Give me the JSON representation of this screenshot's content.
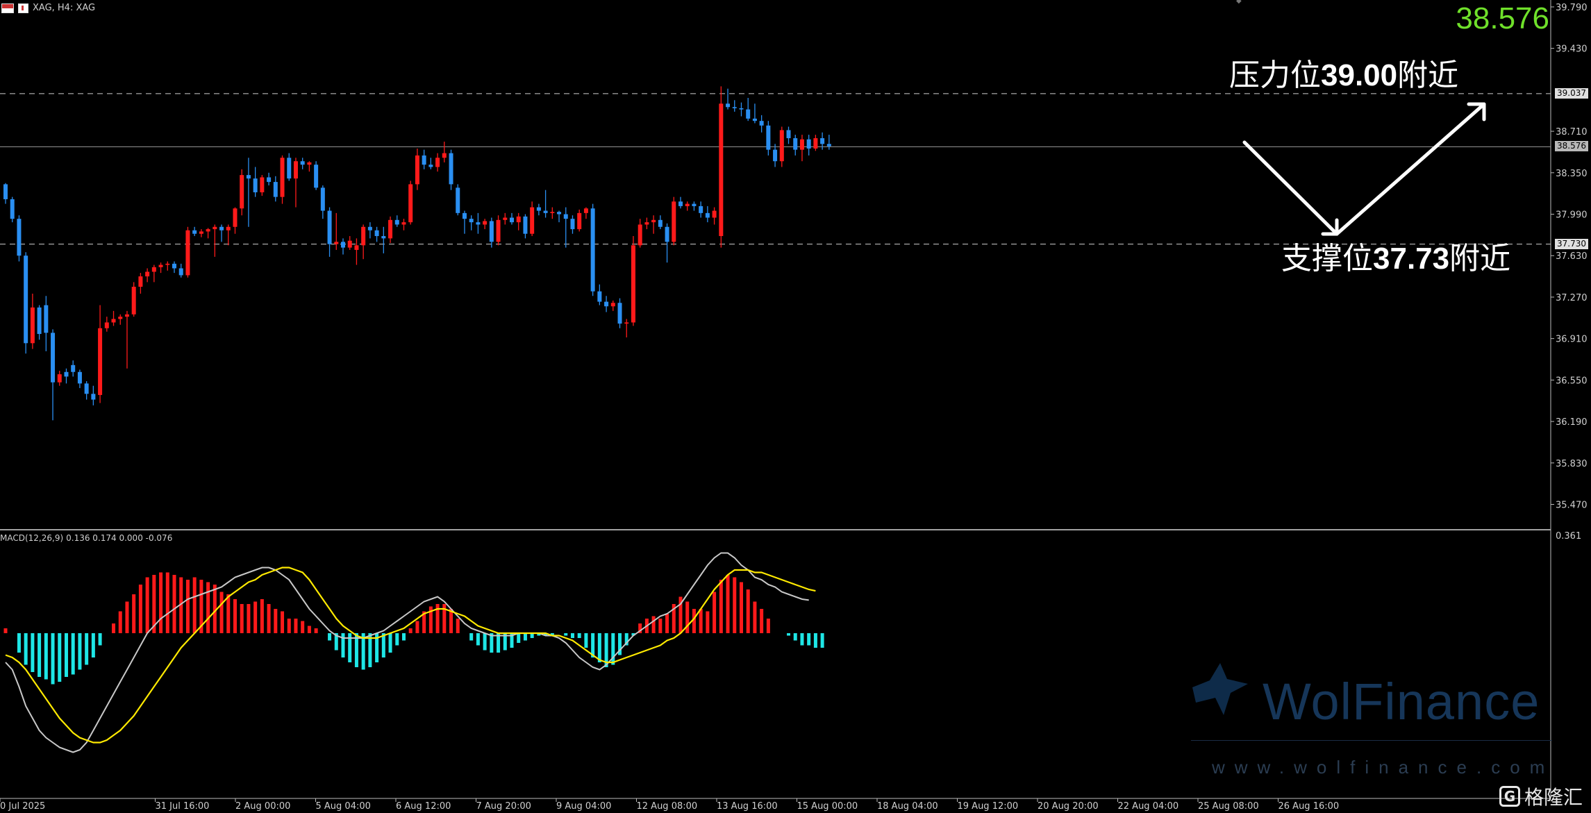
{
  "header": {
    "symbol": "XAG, H4:  XAG"
  },
  "big_price": "38.576",
  "annotations": {
    "resistance_prefix": "压力位",
    "resistance_value": "39.00",
    "resistance_suffix": "附近",
    "support_prefix": "支撑位",
    "support_value": "37.73",
    "support_suffix": "附近"
  },
  "price_axis": {
    "ticks": [
      "39.790",
      "39.430",
      "38.710",
      "38.350",
      "37.990",
      "37.630",
      "37.270",
      "36.910",
      "36.550",
      "36.190",
      "35.830",
      "35.470"
    ],
    "tags": [
      {
        "label": "39.037",
        "value": 39.037,
        "color": "#e0e0e0"
      },
      {
        "label": "38.576",
        "value": 38.576,
        "color": "#b8b8b8"
      },
      {
        "label": "37.730",
        "value": 37.73,
        "color": "#e0e0e0"
      }
    ]
  },
  "macd": {
    "label_name": "MACD(12,26,9)",
    "label_values": "0.136 0.174 0.000 -0.076",
    "axis_top": "0.361"
  },
  "time_axis": [
    "0 Jul 2025",
    "31 Jul 16:00",
    "2 Aug 00:00",
    "5 Aug 04:00",
    "6 Aug 12:00",
    "7 Aug 20:00",
    "9 Aug 04:00",
    "12 Aug 08:00",
    "13 Aug 16:00",
    "15 Aug 00:00",
    "18 Aug 04:00",
    "19 Aug 12:00",
    "20 Aug 20:00",
    "22 Aug 04:00",
    "25 Aug 08:00",
    "26 Aug 16:00"
  ],
  "watermark": {
    "brand": "WolFinance",
    "url": "www.wolfinance.com"
  },
  "corner_brand": {
    "icon": "G",
    "text": "格隆汇"
  },
  "colors": {
    "bull": "#ff1a1a",
    "bear": "#2a8ff2",
    "hist_pos": "#ff1a1a",
    "hist_neg": "#1ee6e6",
    "main_line": "#c8c8c8",
    "signal_line": "#ffea00",
    "price_accent": "#6fe02a"
  },
  "chart_data": {
    "type": "candlestick",
    "title": "XAG, H4",
    "ylim": [
      35.25,
      39.85
    ],
    "ohlc": [
      [
        38.25,
        38.26,
        38.08,
        38.12
      ],
      [
        38.12,
        38.14,
        37.92,
        37.95
      ],
      [
        37.95,
        37.98,
        37.58,
        37.63
      ],
      [
        37.63,
        37.66,
        36.78,
        36.87
      ],
      [
        36.87,
        37.3,
        36.82,
        37.18
      ],
      [
        37.18,
        37.2,
        36.9,
        36.95
      ],
      [
        37.2,
        37.28,
        36.8,
        36.96
      ],
      [
        36.96,
        36.99,
        36.2,
        36.53
      ],
      [
        36.53,
        36.63,
        36.5,
        36.6
      ],
      [
        36.62,
        36.65,
        36.52,
        36.58
      ],
      [
        36.68,
        36.72,
        36.58,
        36.62
      ],
      [
        36.62,
        36.64,
        36.48,
        36.52
      ],
      [
        36.52,
        36.54,
        36.38,
        36.43
      ],
      [
        36.43,
        36.5,
        36.33,
        36.38
      ],
      [
        36.42,
        37.2,
        36.35,
        37.0
      ],
      [
        37.0,
        37.1,
        36.97,
        37.05
      ],
      [
        37.05,
        37.15,
        37.02,
        37.08
      ],
      [
        37.08,
        37.12,
        37.03,
        37.1
      ],
      [
        37.1,
        37.15,
        36.65,
        37.12
      ],
      [
        37.12,
        37.4,
        37.1,
        37.36
      ],
      [
        37.36,
        37.48,
        37.3,
        37.45
      ],
      [
        37.45,
        37.52,
        37.4,
        37.49
      ],
      [
        37.49,
        37.55,
        37.4,
        37.53
      ],
      [
        37.53,
        37.57,
        37.48,
        37.55
      ],
      [
        37.55,
        37.58,
        37.5,
        37.56
      ],
      [
        37.56,
        37.58,
        37.48,
        37.52
      ],
      [
        37.52,
        37.56,
        37.44,
        37.46
      ],
      [
        37.46,
        37.88,
        37.44,
        37.85
      ],
      [
        37.85,
        37.88,
        37.8,
        37.82
      ],
      [
        37.82,
        37.86,
        37.79,
        37.84
      ],
      [
        37.84,
        37.87,
        37.78,
        37.86
      ],
      [
        37.86,
        37.9,
        37.62,
        37.88
      ],
      [
        37.88,
        37.9,
        37.75,
        37.85
      ],
      [
        37.85,
        37.9,
        37.72,
        37.88
      ],
      [
        37.88,
        38.05,
        37.82,
        38.04
      ],
      [
        38.04,
        38.38,
        37.98,
        38.33
      ],
      [
        38.33,
        38.48,
        37.88,
        38.3
      ],
      [
        38.3,
        38.4,
        38.14,
        38.18
      ],
      [
        38.18,
        38.33,
        38.15,
        38.31
      ],
      [
        38.31,
        38.35,
        38.24,
        38.27
      ],
      [
        38.27,
        38.32,
        38.1,
        38.14
      ],
      [
        38.14,
        38.5,
        38.08,
        38.48
      ],
      [
        38.48,
        38.52,
        38.28,
        38.3
      ],
      [
        38.3,
        38.48,
        38.05,
        38.45
      ],
      [
        38.45,
        38.48,
        38.38,
        38.42
      ],
      [
        38.42,
        38.45,
        38.36,
        38.44
      ],
      [
        38.42,
        38.45,
        38.2,
        38.22
      ],
      [
        38.22,
        38.24,
        37.95,
        38.02
      ],
      [
        38.02,
        38.05,
        37.62,
        37.73
      ],
      [
        37.73,
        38.0,
        37.68,
        37.75
      ],
      [
        37.75,
        37.78,
        37.64,
        37.7
      ],
      [
        37.7,
        37.8,
        37.68,
        37.76
      ],
      [
        37.68,
        37.78,
        37.55,
        37.72
      ],
      [
        37.72,
        37.9,
        37.6,
        37.88
      ],
      [
        37.88,
        37.92,
        37.78,
        37.85
      ],
      [
        37.85,
        37.88,
        37.75,
        37.8
      ],
      [
        37.8,
        37.88,
        37.65,
        37.78
      ],
      [
        37.78,
        37.97,
        37.74,
        37.94
      ],
      [
        37.94,
        37.98,
        37.88,
        37.9
      ],
      [
        37.9,
        37.95,
        37.85,
        37.92
      ],
      [
        37.92,
        38.28,
        37.9,
        38.25
      ],
      [
        38.25,
        38.56,
        38.2,
        38.5
      ],
      [
        38.5,
        38.55,
        38.38,
        38.42
      ],
      [
        38.42,
        38.48,
        38.38,
        38.4
      ],
      [
        38.4,
        38.52,
        38.36,
        38.48
      ],
      [
        38.48,
        38.62,
        38.44,
        38.52
      ],
      [
        38.52,
        38.55,
        38.2,
        38.25
      ],
      [
        38.22,
        38.25,
        37.98,
        38.0
      ],
      [
        38.0,
        38.02,
        37.82,
        37.95
      ],
      [
        37.95,
        37.98,
        37.85,
        37.92
      ],
      [
        37.92,
        38.0,
        37.82,
        37.9
      ],
      [
        37.9,
        37.95,
        37.86,
        37.93
      ],
      [
        37.93,
        37.96,
        37.7,
        37.75
      ],
      [
        37.75,
        37.98,
        37.72,
        37.94
      ],
      [
        37.94,
        38.0,
        37.9,
        37.96
      ],
      [
        37.96,
        38.0,
        37.9,
        37.92
      ],
      [
        37.92,
        38.0,
        37.85,
        37.97
      ],
      [
        37.97,
        37.99,
        37.78,
        37.82
      ],
      [
        37.82,
        38.1,
        37.8,
        38.05
      ],
      [
        38.05,
        38.08,
        37.98,
        38.02
      ],
      [
        38.02,
        38.2,
        37.96,
        38.0
      ],
      [
        38.0,
        38.05,
        37.95,
        38.01
      ],
      [
        38.01,
        38.02,
        37.92,
        37.99
      ],
      [
        37.99,
        38.05,
        37.7,
        37.95
      ],
      [
        37.95,
        37.98,
        37.82,
        37.86
      ],
      [
        37.86,
        38.03,
        37.84,
        38.0
      ],
      [
        38.0,
        38.05,
        37.95,
        38.04
      ],
      [
        38.04,
        38.08,
        37.28,
        37.32
      ],
      [
        37.32,
        37.38,
        37.2,
        37.23
      ],
      [
        37.23,
        37.28,
        37.14,
        37.19
      ],
      [
        37.19,
        37.24,
        37.15,
        37.22
      ],
      [
        37.22,
        37.26,
        37.0,
        37.04
      ],
      [
        37.04,
        37.08,
        36.92,
        37.05
      ],
      [
        37.05,
        37.8,
        37.02,
        37.72
      ],
      [
        37.72,
        37.95,
        37.7,
        37.9
      ],
      [
        37.9,
        37.96,
        37.86,
        37.92
      ],
      [
        37.92,
        37.98,
        37.82,
        37.94
      ],
      [
        37.94,
        37.98,
        37.86,
        37.88
      ],
      [
        37.88,
        37.91,
        37.57,
        37.75
      ],
      [
        37.75,
        38.14,
        37.72,
        38.1
      ],
      [
        38.1,
        38.14,
        38.04,
        38.06
      ],
      [
        38.06,
        38.1,
        38.02,
        38.08
      ],
      [
        38.08,
        38.1,
        38.02,
        38.06
      ],
      [
        38.06,
        38.1,
        37.96,
        38.0
      ],
      [
        38.0,
        38.06,
        37.92,
        37.96
      ],
      [
        37.96,
        38.05,
        37.9,
        38.02
      ],
      [
        37.8,
        39.1,
        37.7,
        38.95
      ],
      [
        38.95,
        39.08,
        38.9,
        38.92
      ],
      [
        38.92,
        38.98,
        38.88,
        38.91
      ],
      [
        38.91,
        38.96,
        38.84,
        38.9
      ],
      [
        38.9,
        39.0,
        38.8,
        38.82
      ],
      [
        38.82,
        38.95,
        38.78,
        38.8
      ],
      [
        38.8,
        38.85,
        38.7,
        38.76
      ],
      [
        38.76,
        38.8,
        38.5,
        38.55
      ],
      [
        38.55,
        38.6,
        38.4,
        38.45
      ],
      [
        38.45,
        38.75,
        38.4,
        38.72
      ],
      [
        38.72,
        38.75,
        38.6,
        38.65
      ],
      [
        38.65,
        38.68,
        38.5,
        38.55
      ],
      [
        38.55,
        38.68,
        38.45,
        38.64
      ],
      [
        38.64,
        38.68,
        38.5,
        38.56
      ],
      [
        38.56,
        38.68,
        38.54,
        38.65
      ],
      [
        38.65,
        38.7,
        38.55,
        38.6
      ],
      [
        38.6,
        38.68,
        38.55,
        38.58
      ]
    ],
    "macd_hist": [
      0.02,
      0.0,
      -0.08,
      -0.13,
      -0.16,
      -0.18,
      -0.19,
      -0.21,
      -0.2,
      -0.18,
      -0.17,
      -0.15,
      -0.13,
      -0.1,
      -0.05,
      0.0,
      0.04,
      0.09,
      0.13,
      0.16,
      0.2,
      0.23,
      0.24,
      0.25,
      0.25,
      0.24,
      0.23,
      0.22,
      0.23,
      0.22,
      0.21,
      0.2,
      0.17,
      0.16,
      0.14,
      0.12,
      0.12,
      0.13,
      0.14,
      0.12,
      0.1,
      0.09,
      0.06,
      0.06,
      0.05,
      0.03,
      0.02,
      0.0,
      -0.03,
      -0.07,
      -0.1,
      -0.12,
      -0.14,
      -0.15,
      -0.14,
      -0.12,
      -0.1,
      -0.08,
      -0.05,
      -0.03,
      0.02,
      0.05,
      0.09,
      0.11,
      0.12,
      0.12,
      0.1,
      0.06,
      0.0,
      -0.03,
      -0.05,
      -0.07,
      -0.08,
      -0.08,
      -0.07,
      -0.06,
      -0.04,
      -0.03,
      -0.02,
      -0.01,
      -0.01,
      -0.01,
      0.0,
      -0.01,
      -0.02,
      -0.02,
      -0.06,
      -0.1,
      -0.12,
      -0.14,
      -0.13,
      -0.09,
      -0.05,
      -0.01,
      0.04,
      0.06,
      0.07,
      0.06,
      0.08,
      0.12,
      0.15,
      0.13,
      0.1,
      0.1,
      0.09,
      0.17,
      0.22,
      0.24,
      0.23,
      0.21,
      0.18,
      0.13,
      0.1,
      0.06,
      0.0,
      0.0,
      -0.01,
      -0.03,
      -0.05,
      -0.05,
      -0.06,
      -0.06
    ],
    "macd_main": [
      -0.12,
      -0.15,
      -0.22,
      -0.3,
      -0.35,
      -0.4,
      -0.43,
      -0.45,
      -0.47,
      -0.48,
      -0.49,
      -0.48,
      -0.45,
      -0.4,
      -0.35,
      -0.3,
      -0.25,
      -0.2,
      -0.15,
      -0.1,
      -0.05,
      0.0,
      0.03,
      0.06,
      0.08,
      0.1,
      0.12,
      0.14,
      0.15,
      0.16,
      0.17,
      0.18,
      0.19,
      0.21,
      0.23,
      0.24,
      0.25,
      0.26,
      0.27,
      0.27,
      0.26,
      0.24,
      0.22,
      0.18,
      0.14,
      0.1,
      0.07,
      0.04,
      0.01,
      -0.01,
      -0.02,
      -0.02,
      -0.02,
      -0.02,
      -0.01,
      0.0,
      0.01,
      0.03,
      0.05,
      0.07,
      0.09,
      0.11,
      0.13,
      0.14,
      0.15,
      0.13,
      0.1,
      0.07,
      0.04,
      0.02,
      0.01,
      0.0,
      -0.01,
      -0.01,
      -0.01,
      -0.01,
      0.0,
      0.0,
      0.0,
      0.0,
      -0.01,
      -0.01,
      -0.02,
      -0.04,
      -0.07,
      -0.1,
      -0.12,
      -0.14,
      -0.15,
      -0.13,
      -0.1,
      -0.07,
      -0.04,
      -0.01,
      0.01,
      0.03,
      0.05,
      0.07,
      0.08,
      0.1,
      0.12,
      0.16,
      0.2,
      0.24,
      0.28,
      0.31,
      0.33,
      0.33,
      0.31,
      0.28,
      0.26,
      0.23,
      0.22,
      0.2,
      0.19,
      0.17,
      0.16,
      0.15,
      0.14,
      0.136
    ],
    "macd_signal": [
      -0.09,
      -0.1,
      -0.12,
      -0.15,
      -0.19,
      -0.23,
      -0.27,
      -0.31,
      -0.35,
      -0.38,
      -0.41,
      -0.43,
      -0.44,
      -0.45,
      -0.45,
      -0.44,
      -0.42,
      -0.4,
      -0.37,
      -0.34,
      -0.3,
      -0.26,
      -0.22,
      -0.18,
      -0.14,
      -0.1,
      -0.06,
      -0.03,
      0.0,
      0.03,
      0.06,
      0.09,
      0.12,
      0.15,
      0.17,
      0.19,
      0.21,
      0.22,
      0.24,
      0.25,
      0.26,
      0.27,
      0.27,
      0.26,
      0.25,
      0.22,
      0.18,
      0.14,
      0.1,
      0.06,
      0.03,
      0.01,
      -0.01,
      -0.02,
      -0.02,
      -0.02,
      -0.01,
      0.0,
      0.01,
      0.02,
      0.04,
      0.06,
      0.08,
      0.09,
      0.1,
      0.1,
      0.09,
      0.08,
      0.07,
      0.05,
      0.03,
      0.02,
      0.01,
      0.0,
      0.0,
      0.0,
      0.0,
      0.0,
      0.0,
      0.0,
      0.0,
      -0.01,
      -0.01,
      -0.02,
      -0.03,
      -0.05,
      -0.07,
      -0.09,
      -0.11,
      -0.12,
      -0.12,
      -0.11,
      -0.1,
      -0.09,
      -0.08,
      -0.07,
      -0.06,
      -0.05,
      -0.03,
      -0.02,
      0.0,
      0.03,
      0.06,
      0.1,
      0.14,
      0.18,
      0.21,
      0.24,
      0.26,
      0.26,
      0.26,
      0.25,
      0.25,
      0.24,
      0.23,
      0.22,
      0.21,
      0.2,
      0.19,
      0.18,
      0.174
    ]
  }
}
